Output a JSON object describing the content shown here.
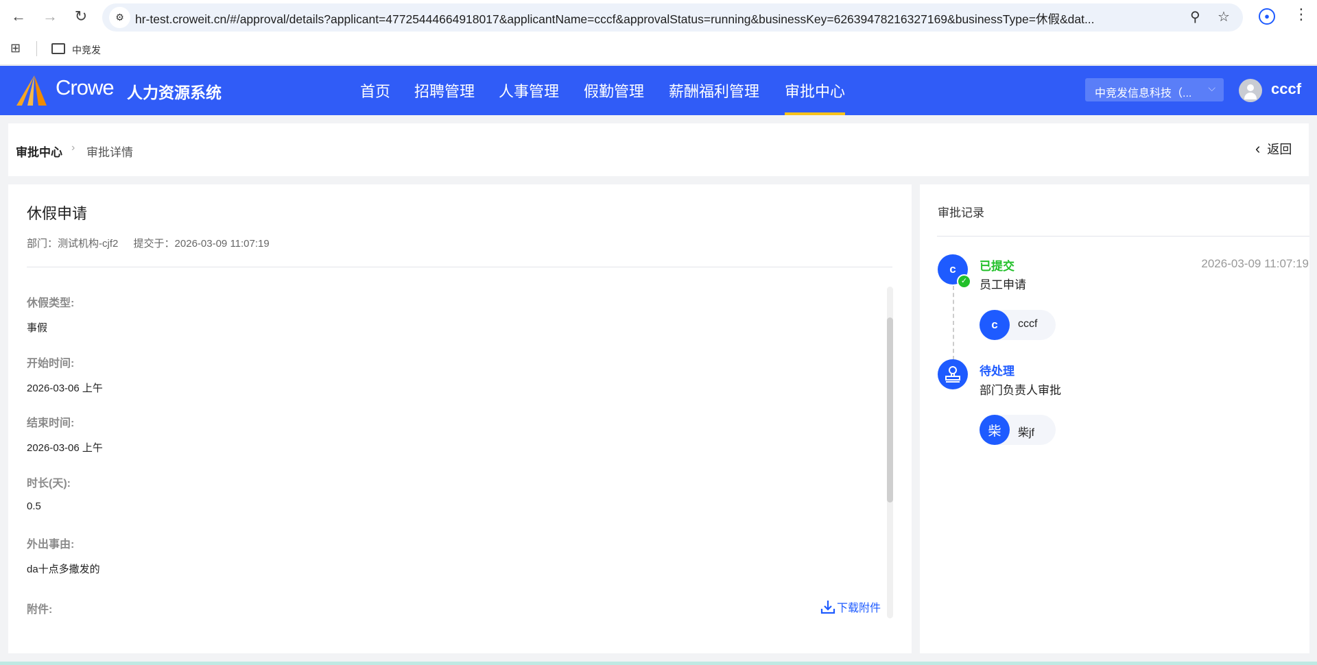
{
  "browser": {
    "url": "hr-test.croweit.cn/#/approval/details?applicant=47725444664918017&applicantName=cccf&approvalStatus=running&businessKey=62639478216327169&businessType=休假&dat...",
    "bookmark_folder": "中竞发"
  },
  "header": {
    "logo_text": "Crowe",
    "system_name": "人力资源系统",
    "nav": [
      "首页",
      "招聘管理",
      "人事管理",
      "假勤管理",
      "薪酬福利管理",
      "审批中心"
    ],
    "active_nav": "审批中心",
    "company_select": "中竞发信息科技（...",
    "username": "cccf",
    "brand_color": "#305cf7",
    "active_underline_color": "#f8c21b"
  },
  "breadcrumb": {
    "parent": "审批中心",
    "current": "审批详情",
    "back_label": "返回"
  },
  "detail": {
    "title": "休假申请",
    "department_label": "部门：",
    "department": "测试机构-cjf2",
    "submitted_label": "提交于：",
    "submitted_at": "2026-03-09 11:07:19",
    "fields": [
      {
        "label": "休假类型:",
        "value": "事假"
      },
      {
        "label": "开始时间:",
        "value": "2026-03-06 上午"
      },
      {
        "label": "结束时间:",
        "value": "2026-03-06 上午"
      },
      {
        "label": "时长(天):",
        "value": "0.5"
      },
      {
        "label": "外出事由:",
        "value": "da十点多撒发的"
      },
      {
        "label": "附件:",
        "value": ""
      }
    ],
    "download_label": "下载附件"
  },
  "record": {
    "title": "审批记录",
    "steps": [
      {
        "status": "已提交",
        "status_color": "#22c02a",
        "node": "员工申请",
        "time": "2026-03-09 11:07:19",
        "avatar": "c",
        "users": [
          {
            "avatar": "c",
            "name": "cccf"
          }
        ]
      },
      {
        "status": "待处理",
        "status_color": "#1e5bff",
        "node": "部门负责人审批",
        "time": "",
        "avatar": "stamp-icon",
        "users": [
          {
            "avatar": "柴",
            "name": "柴jf"
          }
        ]
      }
    ]
  }
}
